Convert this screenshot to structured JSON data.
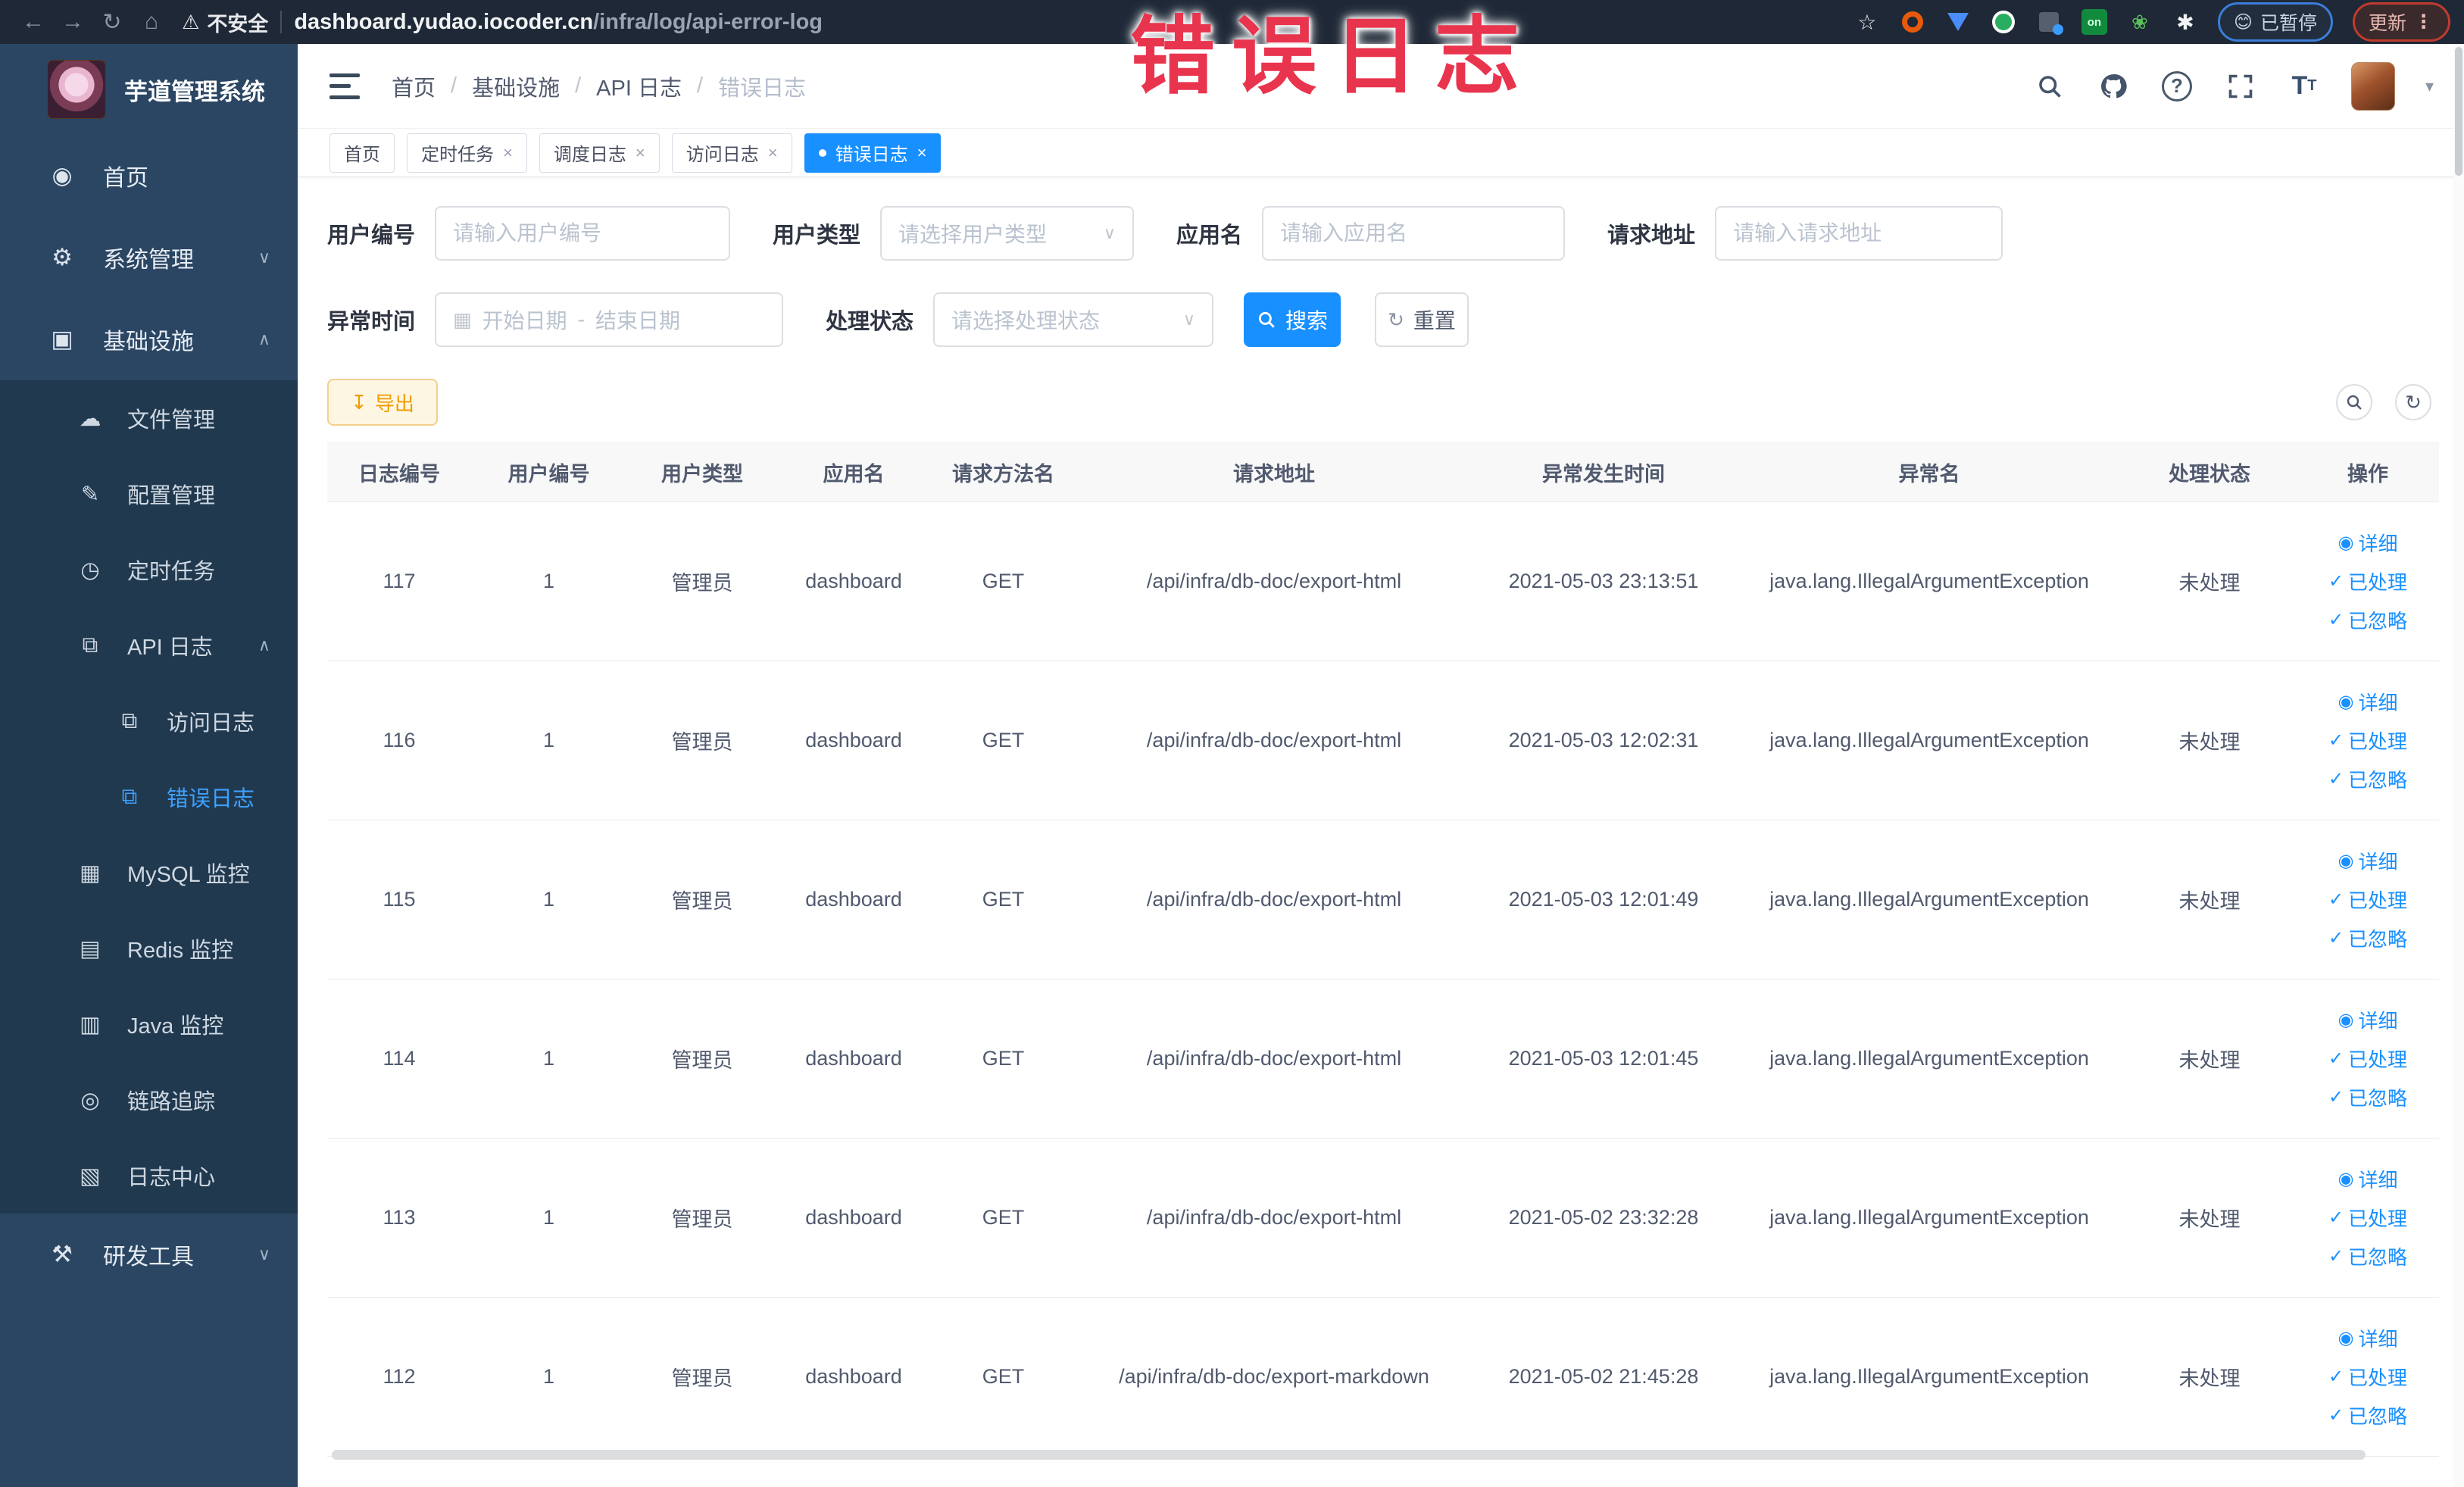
{
  "browser": {
    "security_label": "不安全",
    "url_host": "dashboard.yudao.iocoder.cn",
    "url_path": "/infra/log/api-error-log",
    "paused_badge": "已暂停",
    "update_badge": "更新"
  },
  "overlay": {
    "text": "错误日志",
    "color": "#e9344e"
  },
  "sidebar": {
    "title": "芋道管理系统",
    "home": "首页",
    "system": "系统管理",
    "infra": "基础设施",
    "file": "文件管理",
    "config": "配置管理",
    "job": "定时任务",
    "api_log": "API 日志",
    "access_log": "访问日志",
    "error_log": "错误日志",
    "mysql": "MySQL 监控",
    "redis": "Redis 监控",
    "java": "Java 监控",
    "trace": "链路追踪",
    "log_center": "日志中心",
    "devtools": "研发工具"
  },
  "header": {
    "breadcrumb": [
      "首页",
      "基础设施",
      "API 日志",
      "错误日志"
    ]
  },
  "tabs": [
    {
      "label": "首页"
    },
    {
      "label": "定时任务"
    },
    {
      "label": "调度日志"
    },
    {
      "label": "访问日志"
    },
    {
      "label": "错误日志"
    }
  ],
  "filters": {
    "user_id": {
      "label": "用户编号",
      "placeholder": "请输入用户编号"
    },
    "user_type": {
      "label": "用户类型",
      "placeholder": "请选择用户类型"
    },
    "app_name": {
      "label": "应用名",
      "placeholder": "请输入应用名"
    },
    "request_url": {
      "label": "请求地址",
      "placeholder": "请输入请求地址"
    },
    "exception_time": {
      "label": "异常时间",
      "start_placeholder": "开始日期",
      "end_placeholder": "结束日期",
      "separator": "-"
    },
    "process_status": {
      "label": "处理状态",
      "placeholder": "请选择处理状态"
    },
    "search_label": "搜索",
    "reset_label": "重置"
  },
  "toolbar": {
    "export_label": "导出"
  },
  "table": {
    "columns": [
      "日志编号",
      "用户编号",
      "用户类型",
      "应用名",
      "请求方法名",
      "请求地址",
      "异常发生时间",
      "异常名",
      "处理状态",
      "操作"
    ],
    "actions": [
      "详细",
      "已处理",
      "已忽略"
    ],
    "rows": [
      {
        "id": "117",
        "user_id": "1",
        "user_type": "管理员",
        "app": "dashboard",
        "method": "GET",
        "url": "/api/infra/db-doc/export-html",
        "time": "2021-05-03 23:13:51",
        "exception": "java.lang.IllegalArgumentException",
        "status": "未处理"
      },
      {
        "id": "116",
        "user_id": "1",
        "user_type": "管理员",
        "app": "dashboard",
        "method": "GET",
        "url": "/api/infra/db-doc/export-html",
        "time": "2021-05-03 12:02:31",
        "exception": "java.lang.IllegalArgumentException",
        "status": "未处理"
      },
      {
        "id": "115",
        "user_id": "1",
        "user_type": "管理员",
        "app": "dashboard",
        "method": "GET",
        "url": "/api/infra/db-doc/export-html",
        "time": "2021-05-03 12:01:49",
        "exception": "java.lang.IllegalArgumentException",
        "status": "未处理"
      },
      {
        "id": "114",
        "user_id": "1",
        "user_type": "管理员",
        "app": "dashboard",
        "method": "GET",
        "url": "/api/infra/db-doc/export-html",
        "time": "2021-05-03 12:01:45",
        "exception": "java.lang.IllegalArgumentException",
        "status": "未处理"
      },
      {
        "id": "113",
        "user_id": "1",
        "user_type": "管理员",
        "app": "dashboard",
        "method": "GET",
        "url": "/api/infra/db-doc/export-html",
        "time": "2021-05-02 23:32:28",
        "exception": "java.lang.IllegalArgumentException",
        "status": "未处理"
      },
      {
        "id": "112",
        "user_id": "1",
        "user_type": "管理员",
        "app": "dashboard",
        "method": "GET",
        "url": "/api/infra/db-doc/export-markdown",
        "time": "2021-05-02 21:45:28",
        "exception": "java.lang.IllegalArgumentException",
        "status": "未处理"
      }
    ]
  }
}
